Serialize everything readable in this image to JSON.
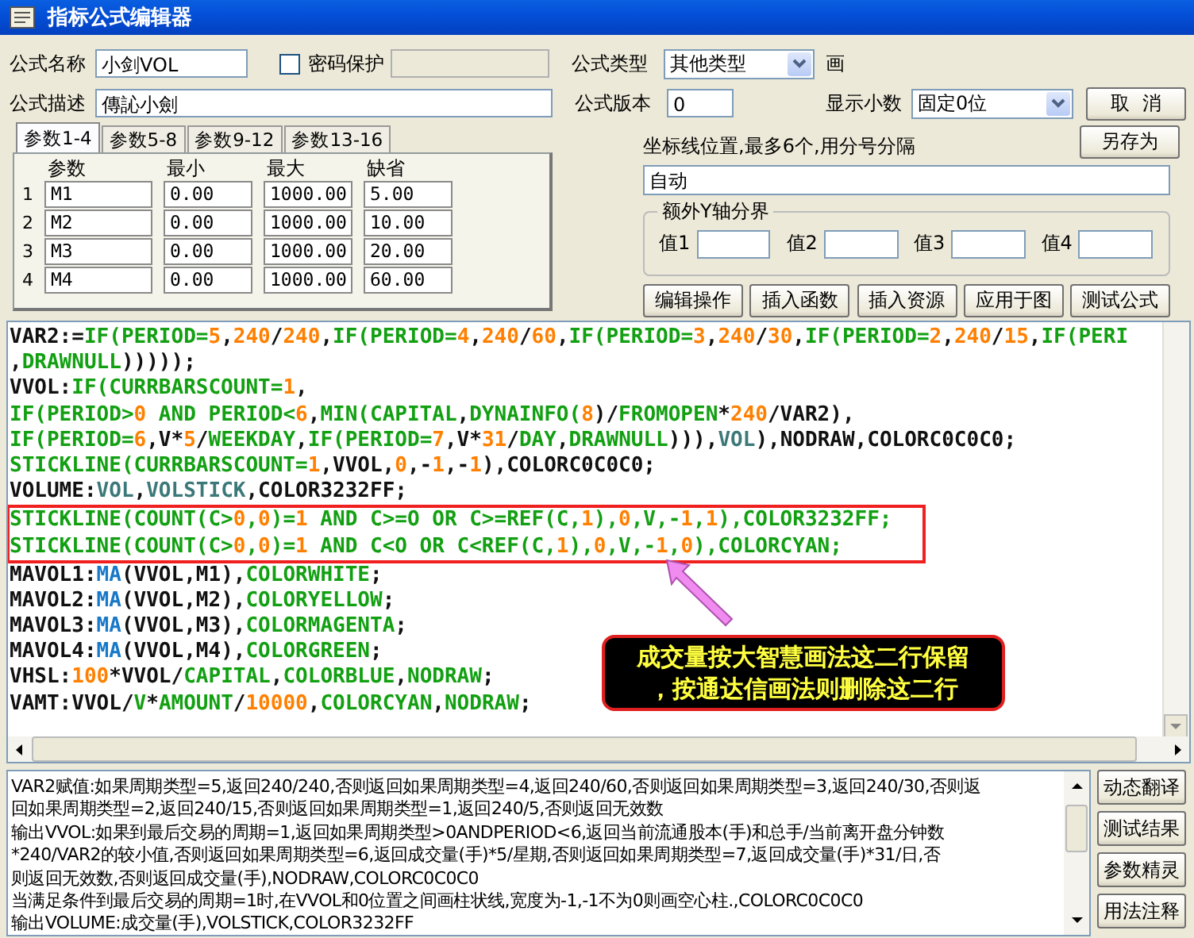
{
  "window": {
    "title": "指标公式编辑器"
  },
  "form": {
    "name_label": "公式名称",
    "name_value": "小剑VOL",
    "password": {
      "label": "密码保护",
      "checked": false
    },
    "type_label": "公式类型",
    "type_value": "其他类型",
    "cut_label": "画",
    "desc_label": "公式描述",
    "desc_value": "傳訫小劍",
    "version_label": "公式版本",
    "version_value": "0",
    "decimals_label": "显示小数",
    "decimals_value": "固定0位",
    "cancel_button": "取  消",
    "save_as_button": "另存为"
  },
  "param_tabs": [
    {
      "label": "参数1-4",
      "selected": true
    },
    {
      "label": "参数5-8",
      "selected": false
    },
    {
      "label": "参数9-12",
      "selected": false
    },
    {
      "label": "参数13-16",
      "selected": false
    }
  ],
  "param_table": {
    "columns": [
      "参数",
      "最小",
      "最大",
      "缺省"
    ],
    "rows": [
      {
        "index": "1",
        "cells": [
          "M1",
          "0.00",
          "1000.00",
          "5.00"
        ]
      },
      {
        "index": "2",
        "cells": [
          "M2",
          "0.00",
          "1000.00",
          "10.00"
        ]
      },
      {
        "index": "3",
        "cells": [
          "M3",
          "0.00",
          "1000.00",
          "20.00"
        ]
      },
      {
        "index": "4",
        "cells": [
          "M4",
          "0.00",
          "1000.00",
          "60.00"
        ]
      }
    ]
  },
  "axis": {
    "label": "坐标线位置,最多6个,用分号分隔",
    "value": "自动"
  },
  "y_bounds": {
    "title": "额外Y轴分界",
    "fields": [
      {
        "label": "值1"
      },
      {
        "label": "值2"
      },
      {
        "label": "值3"
      },
      {
        "label": "值4"
      }
    ]
  },
  "tool_buttons": [
    "编辑操作",
    "插入函数",
    "插入资源",
    "应用于图",
    "测试公式"
  ],
  "code": {
    "lines": [
      {
        "boxed": false,
        "tokens": [
          {
            "text": "VAR2:=",
            "kind": "plain"
          },
          {
            "text": "IF(PERIOD=",
            "kind": "keyword"
          },
          {
            "text": "5",
            "kind": "number"
          },
          {
            "text": ",",
            "kind": "plain"
          },
          {
            "text": "240",
            "kind": "number"
          },
          {
            "text": "/",
            "kind": "plain"
          },
          {
            "text": "240",
            "kind": "number"
          },
          {
            "text": ",",
            "kind": "plain"
          },
          {
            "text": "IF(PERIOD=",
            "kind": "keyword"
          },
          {
            "text": "4",
            "kind": "number"
          },
          {
            "text": ",",
            "kind": "plain"
          },
          {
            "text": "240",
            "kind": "number"
          },
          {
            "text": "/",
            "kind": "plain"
          },
          {
            "text": "60",
            "kind": "number"
          },
          {
            "text": ",",
            "kind": "plain"
          },
          {
            "text": "IF(PERIOD=",
            "kind": "keyword"
          },
          {
            "text": "3",
            "kind": "number"
          },
          {
            "text": ",",
            "kind": "plain"
          },
          {
            "text": "240",
            "kind": "number"
          },
          {
            "text": "/",
            "kind": "plain"
          },
          {
            "text": "30",
            "kind": "number"
          },
          {
            "text": ",",
            "kind": "plain"
          },
          {
            "text": "IF(PERIOD=",
            "kind": "keyword"
          },
          {
            "text": "2",
            "kind": "number"
          },
          {
            "text": ",",
            "kind": "plain"
          },
          {
            "text": "240",
            "kind": "number"
          },
          {
            "text": "/",
            "kind": "plain"
          },
          {
            "text": "15",
            "kind": "number"
          },
          {
            "text": ",",
            "kind": "plain"
          },
          {
            "text": "IF(PERI",
            "kind": "keyword"
          }
        ]
      },
      {
        "boxed": false,
        "tokens": [
          {
            "text": ",",
            "kind": "plain"
          },
          {
            "text": "DRAWNULL",
            "kind": "keyword"
          },
          {
            "text": ")))));",
            "kind": "plain"
          }
        ]
      },
      {
        "boxed": false,
        "tokens": [
          {
            "text": "VVOL:",
            "kind": "plain"
          },
          {
            "text": "IF(CURRBARSCOUNT=",
            "kind": "keyword"
          },
          {
            "text": "1",
            "kind": "number"
          },
          {
            "text": ",",
            "kind": "plain"
          }
        ]
      },
      {
        "boxed": false,
        "tokens": [
          {
            "text": "IF(PERIOD>",
            "kind": "keyword"
          },
          {
            "text": "0",
            "kind": "number"
          },
          {
            "text": " AND PERIOD<",
            "kind": "keyword"
          },
          {
            "text": "6",
            "kind": "number"
          },
          {
            "text": ",",
            "kind": "plain"
          },
          {
            "text": "MIN(CAPITAL",
            "kind": "keyword"
          },
          {
            "text": ",",
            "kind": "plain"
          },
          {
            "text": "DYNAINFO(",
            "kind": "keyword"
          },
          {
            "text": "8",
            "kind": "number"
          },
          {
            "text": ")/",
            "kind": "plain"
          },
          {
            "text": "FROMOPEN",
            "kind": "keyword"
          },
          {
            "text": "*",
            "kind": "plain"
          },
          {
            "text": "240",
            "kind": "number"
          },
          {
            "text": "/VAR2),",
            "kind": "plain"
          }
        ]
      },
      {
        "boxed": false,
        "tokens": [
          {
            "text": "IF(PERIOD=",
            "kind": "keyword"
          },
          {
            "text": "6",
            "kind": "number"
          },
          {
            "text": ",V*",
            "kind": "plain"
          },
          {
            "text": "5",
            "kind": "number"
          },
          {
            "text": "/",
            "kind": "plain"
          },
          {
            "text": "WEEKDAY",
            "kind": "keyword"
          },
          {
            "text": ",",
            "kind": "plain"
          },
          {
            "text": "IF(PERIOD=",
            "kind": "keyword"
          },
          {
            "text": "7",
            "kind": "number"
          },
          {
            "text": ",V*",
            "kind": "plain"
          },
          {
            "text": "31",
            "kind": "number"
          },
          {
            "text": "/",
            "kind": "plain"
          },
          {
            "text": "DAY",
            "kind": "keyword"
          },
          {
            "text": ",",
            "kind": "plain"
          },
          {
            "text": "DRAWNULL",
            "kind": "keyword"
          },
          {
            "text": "))),",
            "kind": "plain"
          },
          {
            "text": "VOL",
            "kind": "variable"
          },
          {
            "text": "),NODRAW,COLORC0C0C0;",
            "kind": "plain"
          }
        ]
      },
      {
        "boxed": false,
        "tokens": [
          {
            "text": "STICKLINE(CURRBARSCOUNT=",
            "kind": "keyword"
          },
          {
            "text": "1",
            "kind": "number"
          },
          {
            "text": ",VVOL,",
            "kind": "plain"
          },
          {
            "text": "0",
            "kind": "number"
          },
          {
            "text": ",-",
            "kind": "plain"
          },
          {
            "text": "1",
            "kind": "number"
          },
          {
            "text": ",-",
            "kind": "plain"
          },
          {
            "text": "1",
            "kind": "number"
          },
          {
            "text": "),COLORC0C0C0;",
            "kind": "plain"
          }
        ]
      },
      {
        "boxed": false,
        "tokens": [
          {
            "text": "VOLUME:",
            "kind": "plain"
          },
          {
            "text": "VOL",
            "kind": "variable"
          },
          {
            "text": ",",
            "kind": "plain"
          },
          {
            "text": "VOLSTICK",
            "kind": "variable"
          },
          {
            "text": ",COLOR3232FF;",
            "kind": "plain"
          }
        ]
      },
      {
        "boxed": true,
        "tokens": [
          {
            "text": "STICKLINE(COUNT(C>",
            "kind": "keyword"
          },
          {
            "text": "0",
            "kind": "number"
          },
          {
            "text": ",",
            "kind": "keyword"
          },
          {
            "text": "0",
            "kind": "number"
          },
          {
            "text": ")=",
            "kind": "keyword"
          },
          {
            "text": "1",
            "kind": "number"
          },
          {
            "text": " AND C>=O OR C>=REF(C,",
            "kind": "keyword"
          },
          {
            "text": "1",
            "kind": "number"
          },
          {
            "text": "),",
            "kind": "keyword"
          },
          {
            "text": "0",
            "kind": "number"
          },
          {
            "text": ",V,-",
            "kind": "keyword"
          },
          {
            "text": "1",
            "kind": "number"
          },
          {
            "text": ",",
            "kind": "keyword"
          },
          {
            "text": "1",
            "kind": "number"
          },
          {
            "text": "),COLOR3232FF;",
            "kind": "keyword"
          }
        ]
      },
      {
        "boxed": true,
        "tokens": [
          {
            "text": "STICKLINE(COUNT(C>",
            "kind": "keyword"
          },
          {
            "text": "0",
            "kind": "number"
          },
          {
            "text": ",",
            "kind": "keyword"
          },
          {
            "text": "0",
            "kind": "number"
          },
          {
            "text": ")=",
            "kind": "keyword"
          },
          {
            "text": "1",
            "kind": "number"
          },
          {
            "text": " AND C<O OR C<REF(C,",
            "kind": "keyword"
          },
          {
            "text": "1",
            "kind": "number"
          },
          {
            "text": "),",
            "kind": "keyword"
          },
          {
            "text": "0",
            "kind": "number"
          },
          {
            "text": ",V,-",
            "kind": "keyword"
          },
          {
            "text": "1",
            "kind": "number"
          },
          {
            "text": ",",
            "kind": "keyword"
          },
          {
            "text": "0",
            "kind": "number"
          },
          {
            "text": "),COLORCYAN;",
            "kind": "keyword"
          }
        ]
      },
      {
        "boxed": false,
        "tokens": [
          {
            "text": "MAVOL1:",
            "kind": "plain"
          },
          {
            "text": "MA",
            "kind": "function"
          },
          {
            "text": "(VVOL,M1),",
            "kind": "plain"
          },
          {
            "text": "COLORWHITE",
            "kind": "keyword"
          },
          {
            "text": ";",
            "kind": "plain"
          }
        ]
      },
      {
        "boxed": false,
        "tokens": [
          {
            "text": "MAVOL2:",
            "kind": "plain"
          },
          {
            "text": "MA",
            "kind": "function"
          },
          {
            "text": "(VVOL,M2),",
            "kind": "plain"
          },
          {
            "text": "COLORYELLOW",
            "kind": "keyword"
          },
          {
            "text": ";",
            "kind": "plain"
          }
        ]
      },
      {
        "boxed": false,
        "tokens": [
          {
            "text": "MAVOL3:",
            "kind": "plain"
          },
          {
            "text": "MA",
            "kind": "function"
          },
          {
            "text": "(VVOL,M3),",
            "kind": "plain"
          },
          {
            "text": "COLORMAGENTA",
            "kind": "keyword"
          },
          {
            "text": ";",
            "kind": "plain"
          }
        ]
      },
      {
        "boxed": false,
        "tokens": [
          {
            "text": "MAVOL4:",
            "kind": "plain"
          },
          {
            "text": "MA",
            "kind": "function"
          },
          {
            "text": "(VVOL,M4),",
            "kind": "plain"
          },
          {
            "text": "COLORGREEN",
            "kind": "keyword"
          },
          {
            "text": ";",
            "kind": "plain"
          }
        ]
      },
      {
        "boxed": false,
        "tokens": [
          {
            "text": "VHSL:",
            "kind": "plain"
          },
          {
            "text": "100",
            "kind": "number"
          },
          {
            "text": "*VVOL/",
            "kind": "plain"
          },
          {
            "text": "CAPITAL",
            "kind": "keyword"
          },
          {
            "text": ",",
            "kind": "plain"
          },
          {
            "text": "COLORBLUE",
            "kind": "keyword"
          },
          {
            "text": ",",
            "kind": "plain"
          },
          {
            "text": "NODRAW",
            "kind": "keyword"
          },
          {
            "text": ";",
            "kind": "plain"
          }
        ]
      },
      {
        "boxed": false,
        "tokens": [
          {
            "text": "VAMT:VVOL/",
            "kind": "plain"
          },
          {
            "text": "V",
            "kind": "keyword"
          },
          {
            "text": "*",
            "kind": "plain"
          },
          {
            "text": "AMOUNT",
            "kind": "keyword"
          },
          {
            "text": "/",
            "kind": "plain"
          },
          {
            "text": "10000",
            "kind": "number"
          },
          {
            "text": ",",
            "kind": "plain"
          },
          {
            "text": "COLORCYAN",
            "kind": "keyword"
          },
          {
            "text": ",",
            "kind": "plain"
          },
          {
            "text": "NODRAW",
            "kind": "keyword"
          },
          {
            "text": ";",
            "kind": "plain"
          }
        ]
      }
    ]
  },
  "callout": {
    "lines": [
      "成交量按大智慧画法这二行保留",
      "，按通达信画法则删除这二行"
    ]
  },
  "description": {
    "lines": [
      "VAR2赋值:如果周期类型=5,返回240/240,否则返回如果周期类型=4,返回240/60,否则返回如果周期类型=3,返回240/30,否则返",
      "回如果周期类型=2,返回240/15,否则返回如果周期类型=1,返回240/5,否则返回无效数",
      "输出VVOL:如果到最后交易的周期=1,返回如果周期类型>0ANDPERIOD<6,返回当前流通股本(手)和总手/当前离开盘分钟数",
      "*240/VAR2的较小值,否则返回如果周期类型=6,返回成交量(手)*5/星期,否则返回如果周期类型=7,返回成交量(手)*31/日,否",
      "则返回无效数,否则返回成交量(手),NODRAW,COLORC0C0C0",
      "当满足条件到最后交易的周期=1时,在VVOL和0位置之间画柱状线,宽度为-1,-1不为0则画空心柱.,COLORC0C0C0",
      "输出VOLUME:成交量(手),VOLSTICK,COLOR3232FF"
    ]
  },
  "side_buttons": [
    "动态翻译",
    "测试结果",
    "参数精灵",
    "用法注释"
  ]
}
